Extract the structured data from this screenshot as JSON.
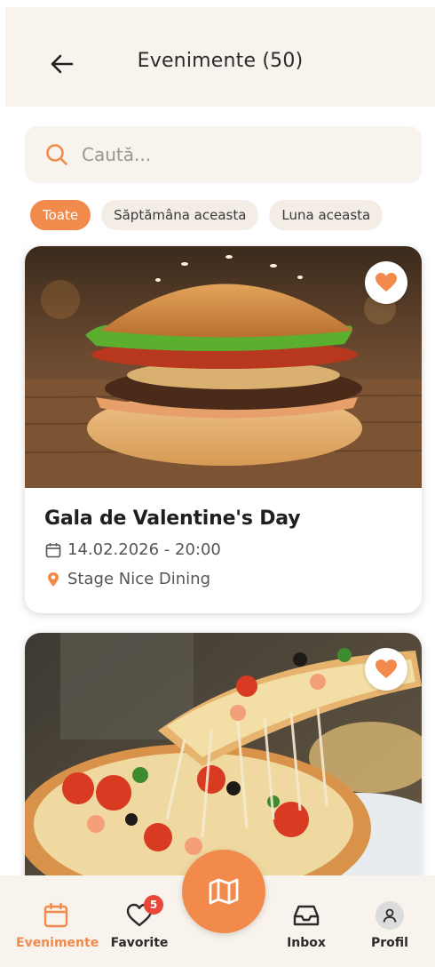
{
  "header": {
    "title": "Evenimente (50)"
  },
  "search": {
    "placeholder": "Caută..."
  },
  "filters": [
    {
      "label": "Toate",
      "active": true
    },
    {
      "label": "Săptămâna aceasta",
      "active": false
    },
    {
      "label": "Luna aceasta",
      "active": false
    }
  ],
  "events": [
    {
      "title": "Gala de Valentine's Day",
      "datetime": "14.02.2026 - 20:00",
      "location": "Stage Nice Dining",
      "favorite": true,
      "image": "burger-photo"
    },
    {
      "title": "",
      "datetime": "",
      "location": "",
      "favorite": true,
      "image": "pizza-photo"
    }
  ],
  "nav": {
    "events_label": "Evenimente",
    "favorites_label": "Favorite",
    "favorites_badge": "5",
    "inbox_label": "Inbox",
    "profile_label": "Profil"
  },
  "colors": {
    "accent": "#f28a4b",
    "header_bg": "#f8f3ec",
    "badge": "#e8473a"
  }
}
